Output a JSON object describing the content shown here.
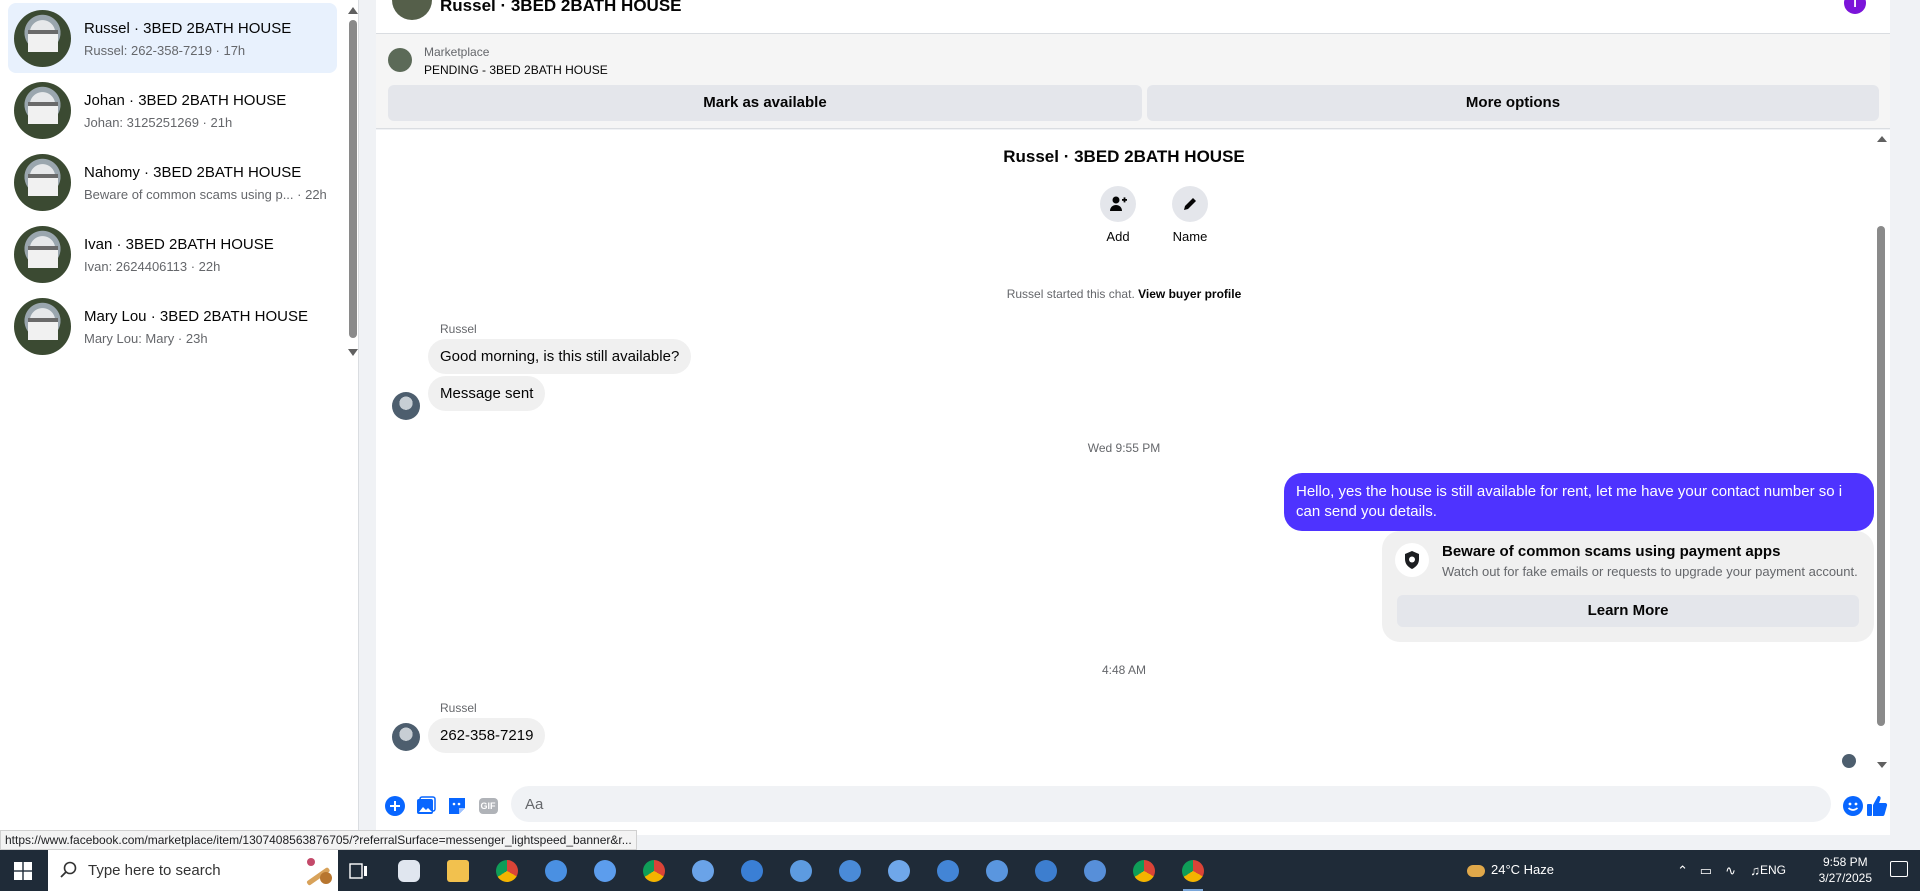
{
  "sidebar": {
    "conversations": [
      {
        "title": "Russel · 3BED 2BATH HOUSE",
        "preview": "Russel: 262-358-7219 · 17h",
        "active": true
      },
      {
        "title": "Johan · 3BED 2BATH HOUSE",
        "preview": "Johan: 3125251269 · 21h",
        "active": false
      },
      {
        "title": "Nahomy · 3BED 2BATH HOUSE",
        "preview": "Beware of common scams using p... · 22h",
        "active": false
      },
      {
        "title": "Ivan · 3BED 2BATH HOUSE",
        "preview": "Ivan: 2624406113 · 22h",
        "active": false
      },
      {
        "title": "Mary Lou · 3BED 2BATH HOUSE",
        "preview": "Mary Lou: Mary · 23h",
        "active": false
      }
    ]
  },
  "header": {
    "title": "Russel · 3BED 2BATH HOUSE",
    "info_icon": "i"
  },
  "marketplace": {
    "label": "Marketplace",
    "status": "PENDING - 3BED 2BATH HOUSE",
    "mark_available_label": "Mark as available",
    "more_options_label": "More options"
  },
  "thread": {
    "title": "Russel · 3BED 2BATH HOUSE",
    "actions": [
      {
        "label": "Add",
        "icon": "add-person-icon"
      },
      {
        "label": "Name",
        "icon": "pencil-icon"
      }
    ],
    "started_text": "Russel started this chat.",
    "view_profile_label": "View buyer profile",
    "messages": [
      {
        "sender": "Russel",
        "text": "Good morning, is this still available?"
      },
      {
        "text": "Message sent"
      }
    ],
    "timestamp1": "Wed 9:55 PM",
    "outgoing": "Hello, yes the house is still available for rent, let me have your contact number so i can send you details.",
    "scam_notice": {
      "title": "Beware of common scams using payment apps",
      "description": "Watch out for fake emails or requests to upgrade your payment account.",
      "button": "Learn More"
    },
    "timestamp2": "4:48 AM",
    "last_message": {
      "sender": "Russel",
      "text": "262-358-7219"
    }
  },
  "composer": {
    "placeholder": "Aa",
    "gif_label": "GIF"
  },
  "status_url": "https://www.facebook.com/marketplace/item/1307408563876705/?referralSurface=messenger_lightspeed_banner&r...",
  "taskbar": {
    "search_placeholder": "Type here to search",
    "weather": "24°C  Haze",
    "language": "ENG",
    "time": "9:58 PM",
    "date": "3/27/2025"
  },
  "colors": {
    "accent": "#0866ff",
    "outgoing_bubble": "#4e33ff",
    "info_icon": "#7b14d9",
    "taskbar": "#1f2b38"
  }
}
